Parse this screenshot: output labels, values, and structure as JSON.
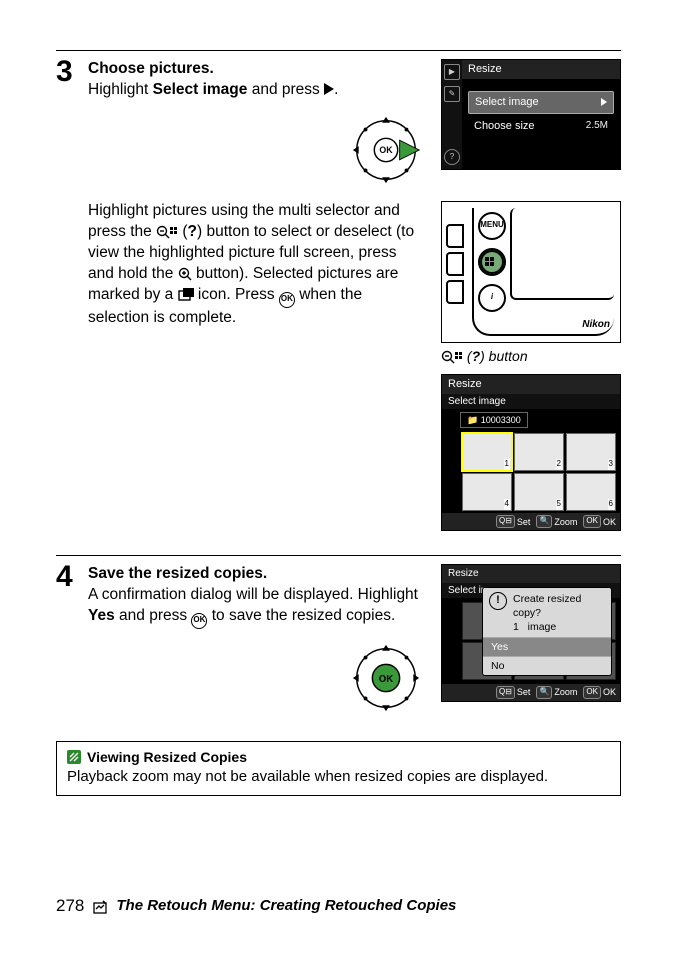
{
  "steps": {
    "s3": {
      "num": "3",
      "heading": "Choose pictures.",
      "para1_a": "Highlight ",
      "para1_bold": "Select image",
      "para1_b": " and press ",
      "para1_end": ".",
      "para2_a": "Highlight pictures using the multi selector and press the ",
      "para2_b": " (",
      "para2_q": "?",
      "para2_c": ") button to select or deselect (to view the highlighted picture full screen, press and hold the ",
      "para2_d": " button). Selected pictures are marked by a ",
      "para2_e": " icon.  Press ",
      "para2_f": " when the selection is complete."
    },
    "s4": {
      "num": "4",
      "heading": "Save the resized copies.",
      "para_a": "A confirmation dialog will be displayed.  Highlight ",
      "para_bold": "Yes",
      "para_b": " and press ",
      "para_c": " to save the resized copies."
    }
  },
  "ok_label": "OK",
  "screens": {
    "resize_menu": {
      "title": "Resize",
      "row_select": "Select image",
      "row_size": "Choose size",
      "size_val": "2.5M"
    },
    "thumb": {
      "title": "Resize",
      "sub": "Select image",
      "folder": "10003300",
      "nums": [
        "1",
        "2",
        "3",
        "4",
        "5",
        "6"
      ],
      "foot_set": "Set",
      "foot_zoom": "Zoom",
      "foot_ok": "OK"
    },
    "confirm": {
      "title": "Resize",
      "sub": "Select image",
      "msg_l1": "Create resized copy?",
      "msg_l2a": "1",
      "msg_l2b": "image",
      "yes": "Yes",
      "no": "No",
      "foot_set": "Set",
      "foot_zoom": "Zoom",
      "foot_ok": "OK"
    }
  },
  "captions": {
    "button_label_a": " (",
    "button_label_q": "?",
    "button_label_b": ") button"
  },
  "camera": {
    "brand": "Nikon",
    "btn_menu": "MENU",
    "btn_i": "i"
  },
  "note": {
    "title": "Viewing Resized Copies",
    "body": "Playback zoom may not be available when resized copies are displayed."
  },
  "footer": {
    "page": "278",
    "section": "The Retouch Menu: Creating Retouched Copies"
  }
}
